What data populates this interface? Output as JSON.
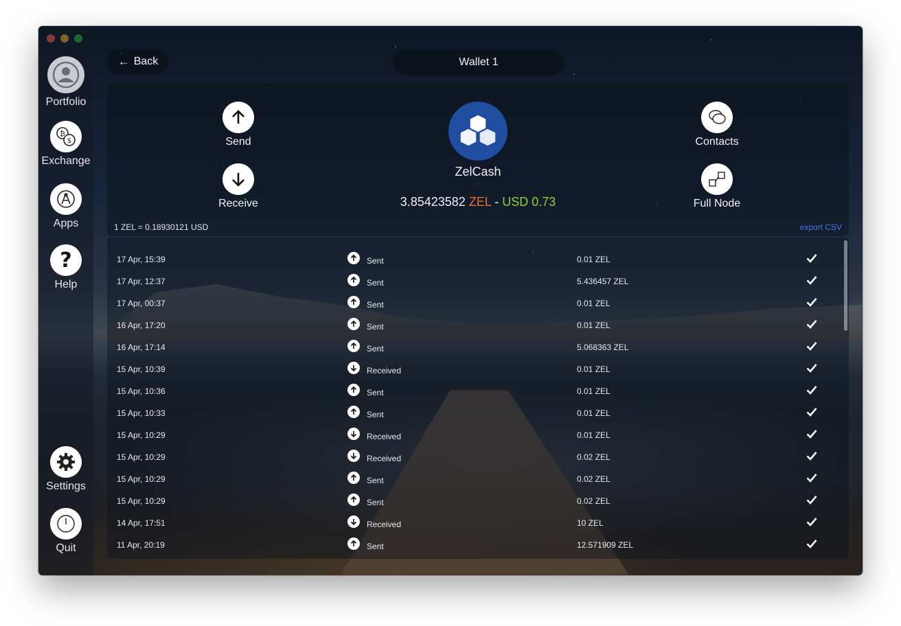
{
  "window": {
    "title": "Wallet 1"
  },
  "colors": {
    "accent_zel": "#e8742c",
    "accent_usd": "#8bd236",
    "link": "#3b7be8",
    "coin_blue": "#1f4ea1"
  },
  "sidebar": {
    "items": [
      {
        "label": "Portfolio",
        "icon": "user-avatar-icon"
      },
      {
        "label": "Exchange",
        "icon": "currency-exchange-icon"
      },
      {
        "label": "Apps",
        "icon": "apps-icon"
      },
      {
        "label": "Help",
        "icon": "question-icon"
      },
      {
        "label": "Settings",
        "icon": "gear-icon"
      },
      {
        "label": "Quit",
        "icon": "power-icon"
      }
    ]
  },
  "header": {
    "back_label": "Back",
    "title": "Wallet 1"
  },
  "wallet": {
    "send_label": "Send",
    "receive_label": "Receive",
    "contacts_label": "Contacts",
    "fullnode_label": "Full Node",
    "coin_name": "ZelCash",
    "balance_amount": "3.85423582",
    "balance_unit": "ZEL",
    "balance_separator": "-",
    "balance_usd": "USD 0.73",
    "rate": "1 ZEL = 0.18930121 USD",
    "export_label": "export CSV"
  },
  "transactions": [
    {
      "date": "17 Apr, 15:39",
      "direction": "Sent",
      "amount": "0.01 ZEL"
    },
    {
      "date": "17 Apr, 12:37",
      "direction": "Sent",
      "amount": "5.436457 ZEL"
    },
    {
      "date": "17 Apr, 00:37",
      "direction": "Sent",
      "amount": "0.01 ZEL"
    },
    {
      "date": "16 Apr, 17:20",
      "direction": "Sent",
      "amount": "0.01 ZEL"
    },
    {
      "date": "16 Apr, 17:14",
      "direction": "Sent",
      "amount": "5.068363 ZEL"
    },
    {
      "date": "15 Apr, 10:39",
      "direction": "Received",
      "amount": "0.01 ZEL"
    },
    {
      "date": "15 Apr, 10:36",
      "direction": "Sent",
      "amount": "0.01 ZEL"
    },
    {
      "date": "15 Apr, 10:33",
      "direction": "Sent",
      "amount": "0.01 ZEL"
    },
    {
      "date": "15 Apr, 10:29",
      "direction": "Received",
      "amount": "0.01 ZEL"
    },
    {
      "date": "15 Apr, 10:29",
      "direction": "Received",
      "amount": "0.02 ZEL"
    },
    {
      "date": "15 Apr, 10:29",
      "direction": "Sent",
      "amount": "0.02 ZEL"
    },
    {
      "date": "15 Apr, 10:29",
      "direction": "Sent",
      "amount": "0.02 ZEL"
    },
    {
      "date": "14 Apr, 17:51",
      "direction": "Received",
      "amount": "10 ZEL"
    },
    {
      "date": "11 Apr, 20:19",
      "direction": "Sent",
      "amount": "12.571909 ZEL"
    }
  ]
}
